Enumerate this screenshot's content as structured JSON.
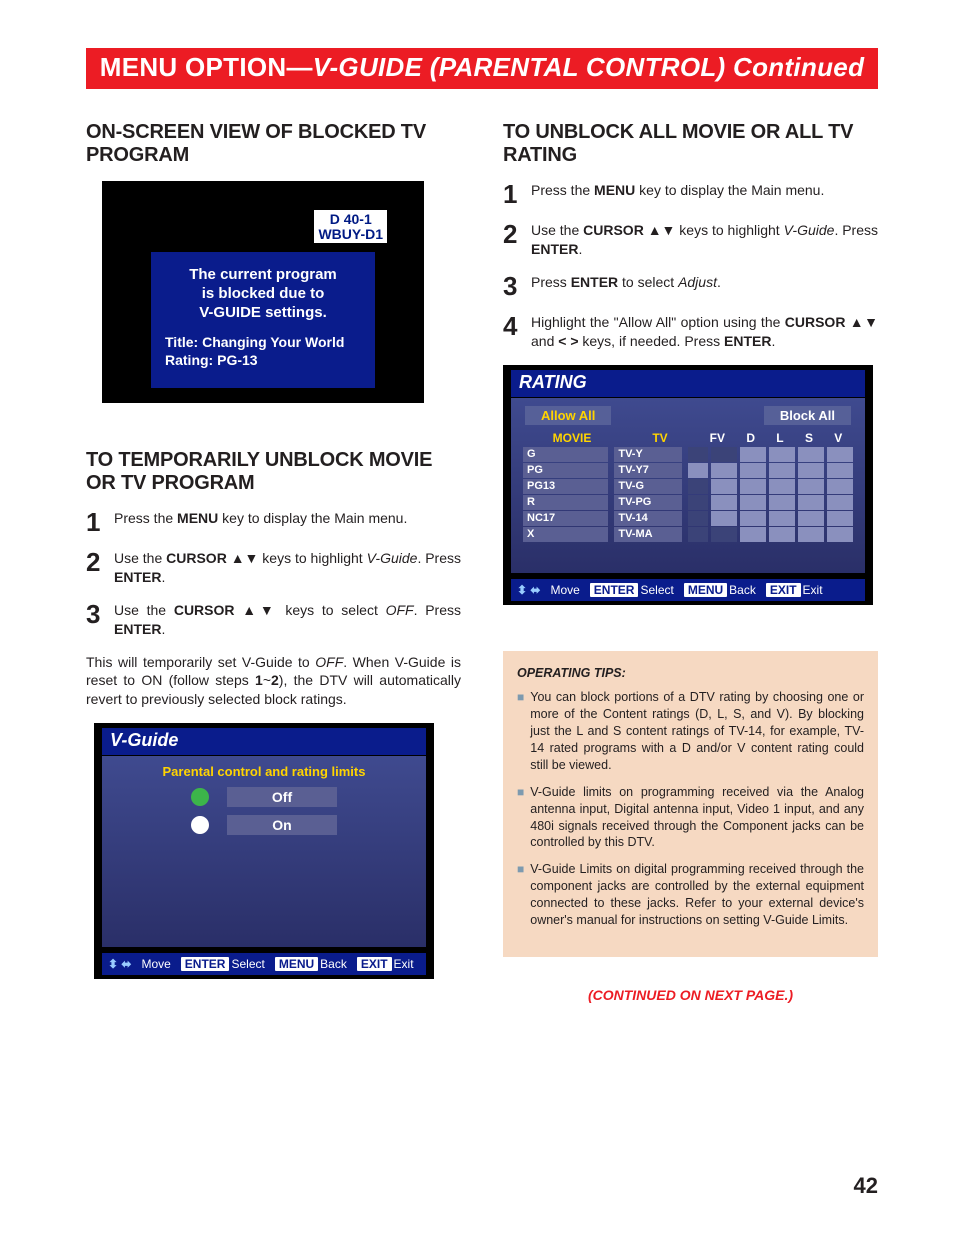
{
  "banner": {
    "prefix": "MENU OPTION—",
    "title": "V-GUIDE  (PARENTAL CONTROL) Continued"
  },
  "page_number": "42",
  "left": {
    "heading1": "ON-SCREEN VIEW OF BLOCKED TV PROGRAM",
    "blocked_screen": {
      "badge_line1": "D 40-1",
      "badge_line2": "WBUY-D1",
      "msg_line1": "The current program",
      "msg_line2": "is blocked due to",
      "msg_line3": "V-GUIDE settings.",
      "meta_title": "Title: Changing Your World",
      "meta_rating": "Rating: PG-13"
    },
    "heading2": "TO TEMPORARILY UNBLOCK MOVIE OR TV PROGRAM",
    "steps": [
      {
        "n": "1",
        "html": "Press the <b>MENU</b> key to display the Main menu."
      },
      {
        "n": "2",
        "html": "Use the <b>CURSOR</b> ▲▼ keys to highlight <i>V-Guide</i>. Press <b>ENTER</b>."
      },
      {
        "n": "3",
        "html": "Use the <b>CURSOR</b> ▲▼ keys to select <i>OFF</i>. Press <b>ENTER</b>."
      }
    ],
    "after_html": "This will temporarily set V-Guide to <i>OFF</i>. When V-Guide is reset to ON (follow steps <b>1</b>~<b>2</b>), the DTV will automatically revert to previously selected block ratings.",
    "vguide_screen": {
      "title": "V-Guide",
      "cap": "Parental control and rating limits",
      "rows": [
        {
          "sel": true,
          "label": "Off"
        },
        {
          "sel": false,
          "label": "On"
        }
      ],
      "osd": {
        "move": "Move",
        "enter": "ENTER",
        "select": "Select",
        "menu": "MENU",
        "back": "Back",
        "exit_k": "EXIT",
        "exit": "Exit"
      }
    }
  },
  "right": {
    "heading": "TO UNBLOCK ALL MOVIE OR ALL TV RATING",
    "steps": [
      {
        "n": "1",
        "html": "Press the <b>MENU</b> key to display the Main menu."
      },
      {
        "n": "2",
        "html": "Use the <b>CURSOR</b> ▲▼ keys to highlight <i>V-Guide</i>. Press <b>ENTER</b>."
      },
      {
        "n": "3",
        "html": "Press <b>ENTER</b> to select <i>Adjust</i>."
      },
      {
        "n": "4",
        "html": "Highlight the \"Allow All\" option using the <b>CURSOR</b> ▲▼ and <b>&lt; &gt;</b> keys, if needed. Press <b>ENTER</b>."
      }
    ],
    "rating_screen": {
      "title": "RATING",
      "allow": "Allow All",
      "block": "Block All",
      "col_movie": "MOVIE",
      "col_tv": "TV",
      "content_cols": [
        "FV",
        "D",
        "L",
        "S",
        "V"
      ],
      "movie": [
        "G",
        "PG",
        "PG13",
        "R",
        "NC17",
        "X"
      ],
      "tv": [
        "TV-Y",
        "TV-Y7",
        "TV-G",
        "TV-PG",
        "TV-14",
        "TV-MA"
      ],
      "boxes": [
        [
          0,
          0,
          1,
          1,
          1,
          1
        ],
        [
          1,
          1,
          1,
          1,
          1,
          1
        ],
        [
          0,
          1,
          1,
          1,
          1,
          1
        ],
        [
          0,
          1,
          1,
          1,
          1,
          1
        ],
        [
          0,
          1,
          1,
          1,
          1,
          1
        ],
        [
          0,
          0,
          1,
          1,
          1,
          1
        ]
      ],
      "osd": {
        "move": "Move",
        "enter": "ENTER",
        "select": "Select",
        "menu": "MENU",
        "back": "Back",
        "exit_k": "EXIT",
        "exit": "Exit"
      }
    },
    "tips": {
      "title": "OPERATING TIPS:",
      "items": [
        "You can block portions of a DTV rating by choosing one or more of the Content ratings (D, L, S, and V). By blocking just the L and S content ratings of TV-14, for example, TV-14 rated programs with a D and/or V content rating could still be viewed.",
        "V-Guide limits on programming received via the Analog antenna input, Digital antenna input, Video 1 input, and any 480i signals received through the Component jacks can be controlled by this DTV.",
        "V-Guide Limits on digital programming received through the component jacks are controlled by the external equipment connected to these jacks. Refer to your external device's owner's manual for instructions on setting V-Guide Limits."
      ]
    },
    "continue": "(CONTINUED ON NEXT PAGE.)"
  }
}
